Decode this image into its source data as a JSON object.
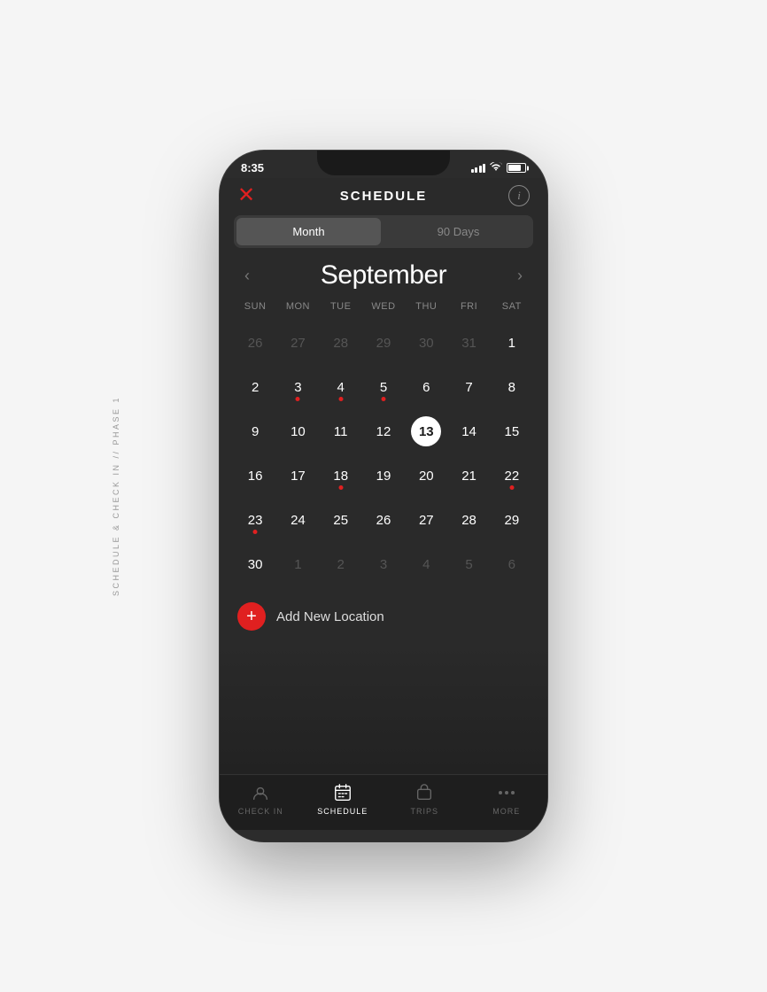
{
  "side_label": "SCHEDULE & CHECK IN // PHASE 1",
  "status_bar": {
    "time": "8:35",
    "signal": "bars",
    "wifi": "wifi",
    "battery": "battery"
  },
  "header": {
    "back_icon": "+",
    "title": "SCHEDULE",
    "info_icon": "i"
  },
  "toggle": {
    "month_label": "Month",
    "days_label": "90 Days",
    "active": "month"
  },
  "calendar": {
    "month": "September",
    "day_headers": [
      "SUN",
      "MON",
      "TUE",
      "WED",
      "THU",
      "FRI",
      "SAT"
    ],
    "weeks": [
      [
        {
          "day": "26",
          "dimmed": true,
          "today": false,
          "dot": false
        },
        {
          "day": "27",
          "dimmed": true,
          "today": false,
          "dot": false
        },
        {
          "day": "28",
          "dimmed": true,
          "today": false,
          "dot": false
        },
        {
          "day": "29",
          "dimmed": true,
          "today": false,
          "dot": false
        },
        {
          "day": "30",
          "dimmed": true,
          "today": false,
          "dot": false
        },
        {
          "day": "31",
          "dimmed": true,
          "today": false,
          "dot": false
        },
        {
          "day": "1",
          "dimmed": false,
          "today": false,
          "dot": false
        }
      ],
      [
        {
          "day": "2",
          "dimmed": false,
          "today": false,
          "dot": false
        },
        {
          "day": "3",
          "dimmed": false,
          "today": false,
          "dot": true
        },
        {
          "day": "4",
          "dimmed": false,
          "today": false,
          "dot": true
        },
        {
          "day": "5",
          "dimmed": false,
          "today": false,
          "dot": true
        },
        {
          "day": "6",
          "dimmed": false,
          "today": false,
          "dot": false
        },
        {
          "day": "7",
          "dimmed": false,
          "today": false,
          "dot": false
        },
        {
          "day": "8",
          "dimmed": false,
          "today": false,
          "dot": false
        }
      ],
      [
        {
          "day": "9",
          "dimmed": false,
          "today": false,
          "dot": false
        },
        {
          "day": "10",
          "dimmed": false,
          "today": false,
          "dot": false
        },
        {
          "day": "11",
          "dimmed": false,
          "today": false,
          "dot": false
        },
        {
          "day": "12",
          "dimmed": false,
          "today": false,
          "dot": false
        },
        {
          "day": "13",
          "dimmed": false,
          "today": true,
          "dot": false
        },
        {
          "day": "14",
          "dimmed": false,
          "today": false,
          "dot": false
        },
        {
          "day": "15",
          "dimmed": false,
          "today": false,
          "dot": false
        }
      ],
      [
        {
          "day": "16",
          "dimmed": false,
          "today": false,
          "dot": false
        },
        {
          "day": "17",
          "dimmed": false,
          "today": false,
          "dot": false
        },
        {
          "day": "18",
          "dimmed": false,
          "today": false,
          "dot": true
        },
        {
          "day": "19",
          "dimmed": false,
          "today": false,
          "dot": false
        },
        {
          "day": "20",
          "dimmed": false,
          "today": false,
          "dot": false
        },
        {
          "day": "21",
          "dimmed": false,
          "today": false,
          "dot": false
        },
        {
          "day": "22",
          "dimmed": false,
          "today": false,
          "dot": true
        }
      ],
      [
        {
          "day": "23",
          "dimmed": false,
          "today": false,
          "dot": true
        },
        {
          "day": "24",
          "dimmed": false,
          "today": false,
          "dot": false
        },
        {
          "day": "25",
          "dimmed": false,
          "today": false,
          "dot": false
        },
        {
          "day": "26",
          "dimmed": false,
          "today": false,
          "dot": false
        },
        {
          "day": "27",
          "dimmed": false,
          "today": false,
          "dot": false
        },
        {
          "day": "28",
          "dimmed": false,
          "today": false,
          "dot": false
        },
        {
          "day": "29",
          "dimmed": false,
          "today": false,
          "dot": false
        }
      ],
      [
        {
          "day": "30",
          "dimmed": false,
          "today": false,
          "dot": false
        },
        {
          "day": "1",
          "dimmed": true,
          "today": false,
          "dot": false
        },
        {
          "day": "2",
          "dimmed": true,
          "today": false,
          "dot": false
        },
        {
          "day": "3",
          "dimmed": true,
          "today": false,
          "dot": false
        },
        {
          "day": "4",
          "dimmed": true,
          "today": false,
          "dot": false
        },
        {
          "day": "5",
          "dimmed": true,
          "today": false,
          "dot": false
        },
        {
          "day": "6",
          "dimmed": true,
          "today": false,
          "dot": false
        }
      ]
    ]
  },
  "add_location": {
    "label": "Add New Location"
  },
  "tab_bar": {
    "tabs": [
      {
        "id": "checkin",
        "label": "CHECK IN",
        "active": false
      },
      {
        "id": "schedule",
        "label": "SCHEDULE",
        "active": true
      },
      {
        "id": "trips",
        "label": "TRIPS",
        "active": false
      },
      {
        "id": "more",
        "label": "MORE",
        "active": false
      }
    ]
  }
}
